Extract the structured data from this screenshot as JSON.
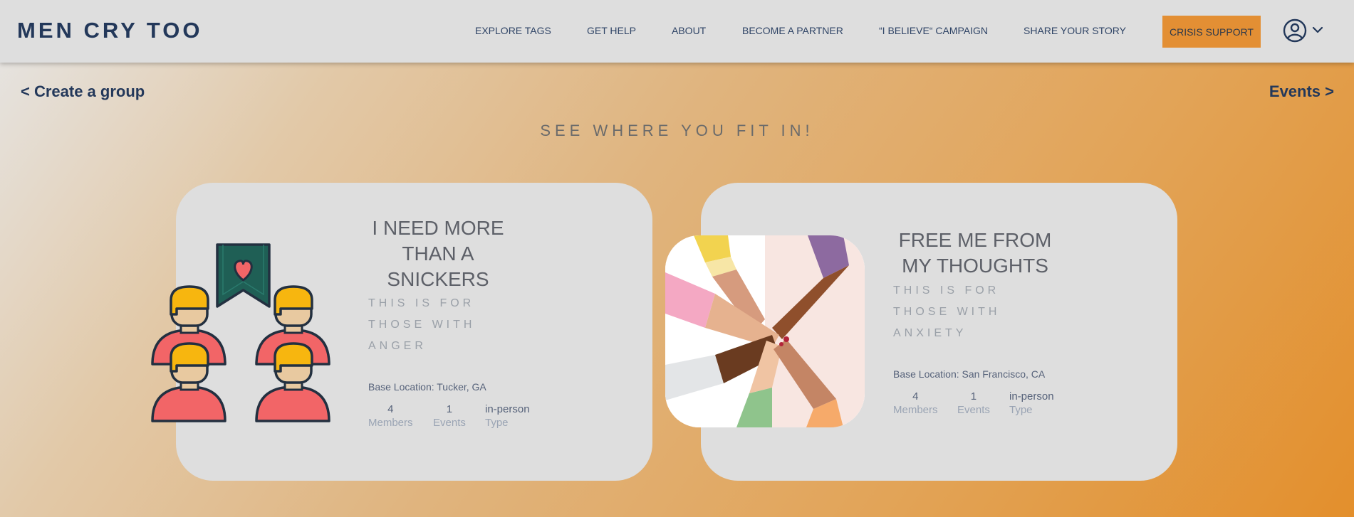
{
  "header": {
    "logo": "MEN CRY TOO",
    "nav": [
      "EXPLORE TAGS",
      "GET HELP",
      "ABOUT",
      "BECOME A PARTNER",
      "“I BELIEVE“ CAMPAIGN",
      "SHARE YOUR STORY"
    ],
    "crisis_label": "CRISIS SUPPORT"
  },
  "links": {
    "back": "< Create a group",
    "forward": "Events >"
  },
  "headline": "SEE WHERE YOU FIT IN!",
  "groups": [
    {
      "title": "I NEED MORE THAN A SNICKERS",
      "subtitle": "THIS IS FOR THOSE WITH ANGER",
      "location": "Base Location: Tucker, GA",
      "stats": [
        {
          "value": "4",
          "label": "Members"
        },
        {
          "value": "1",
          "label": "Events"
        },
        {
          "value": "in-person",
          "label": "Type"
        }
      ]
    },
    {
      "title": "FREE ME FROM MY THOUGHTS",
      "subtitle": "THIS IS FOR THOSE WITH ANXIETY",
      "location": "Base Location: San Francisco, CA",
      "stats": [
        {
          "value": "4",
          "label": "Members"
        },
        {
          "value": "1",
          "label": "Events"
        },
        {
          "value": "in-person",
          "label": "Type"
        }
      ]
    }
  ],
  "colors": {
    "brand": "#23385a",
    "crisis": "#e38f34",
    "card": "#dedede"
  }
}
